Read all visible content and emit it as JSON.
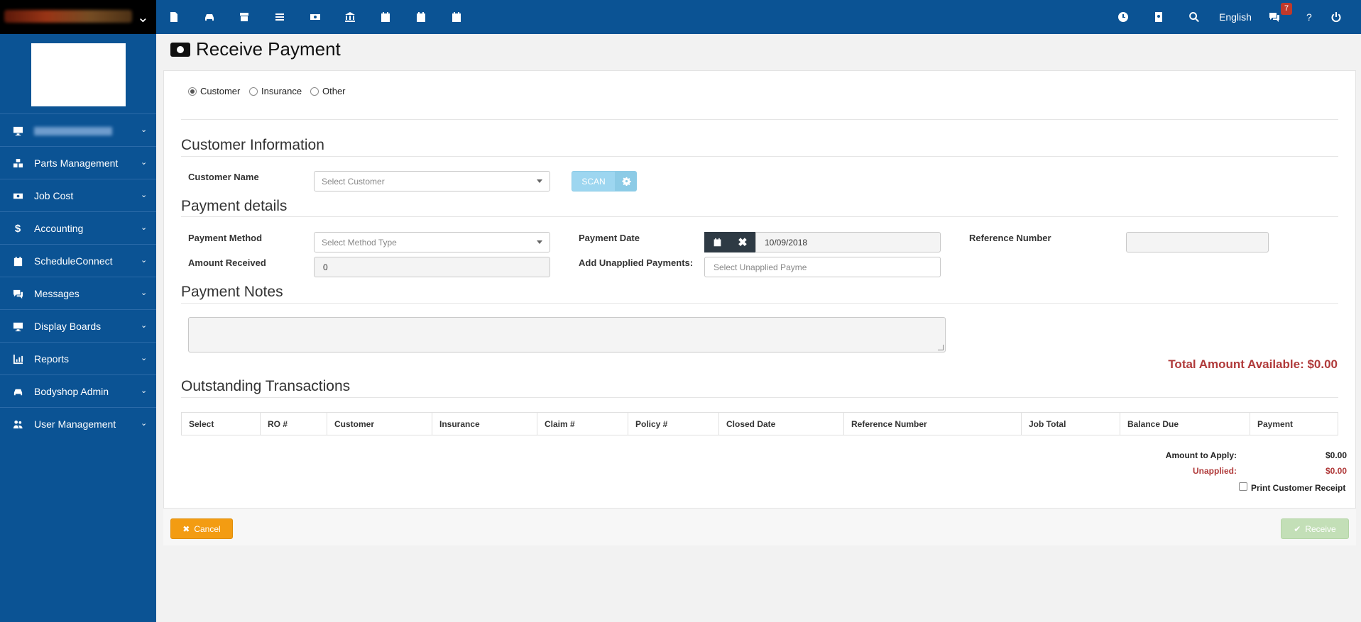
{
  "topbar": {
    "language": "English",
    "messages_count": "7",
    "help": "?"
  },
  "sidebar": {
    "items": [
      {
        "label": "",
        "icon": "monitor-icon",
        "blurred": true
      },
      {
        "label": "Parts Management",
        "icon": "cubes-icon"
      },
      {
        "label": "Job Cost",
        "icon": "money-icon"
      },
      {
        "label": "Accounting",
        "icon": "dollar-icon"
      },
      {
        "label": "ScheduleConnect",
        "icon": "calendar-icon"
      },
      {
        "label": "Messages",
        "icon": "chat-icon"
      },
      {
        "label": "Display Boards",
        "icon": "monitor-icon"
      },
      {
        "label": "Reports",
        "icon": "chart-icon"
      },
      {
        "label": "Bodyshop Admin",
        "icon": "car-icon"
      },
      {
        "label": "User Management",
        "icon": "users-icon"
      }
    ]
  },
  "page": {
    "title": "Receive Payment"
  },
  "payer_type": {
    "options": [
      "Customer",
      "Insurance",
      "Other"
    ],
    "selected": "Customer"
  },
  "customer_info": {
    "section_title": "Customer Information",
    "customer_name_label": "Customer Name",
    "customer_placeholder": "Select Customer",
    "scan_label": "SCAN"
  },
  "payment_details": {
    "section_title": "Payment details",
    "payment_method_label": "Payment Method",
    "payment_method_placeholder": "Select Method Type",
    "amount_received_label": "Amount Received",
    "amount_received_value": "0",
    "payment_date_label": "Payment Date",
    "payment_date_value": "10/09/2018",
    "add_unapplied_label": "Add Unapplied Payments:",
    "add_unapplied_placeholder": "Select Unapplied Payme",
    "reference_number_label": "Reference Number"
  },
  "payment_notes": {
    "section_title": "Payment Notes",
    "total_available": "Total Amount Available: $0.00"
  },
  "transactions": {
    "section_title": "Outstanding Transactions",
    "columns": [
      "Select",
      "RO #",
      "Customer",
      "Insurance",
      "Claim #",
      "Policy #",
      "Closed Date",
      "Reference Number",
      "Job Total",
      "Balance Due",
      "Payment"
    ]
  },
  "summary": {
    "amount_to_apply_label": "Amount to Apply:",
    "amount_to_apply_value": "$0.00",
    "unapplied_label": "Unapplied:",
    "unapplied_value": "$0.00",
    "print_receipt_label": "Print Customer Receipt"
  },
  "actions": {
    "cancel_label": "Cancel",
    "receive_label": "Receive"
  },
  "colors": {
    "nav_blue": "#0b5394",
    "cancel_orange": "#f39c12",
    "receive_green_disabled": "#c3dfb7",
    "total_red": "#b03a3a"
  }
}
